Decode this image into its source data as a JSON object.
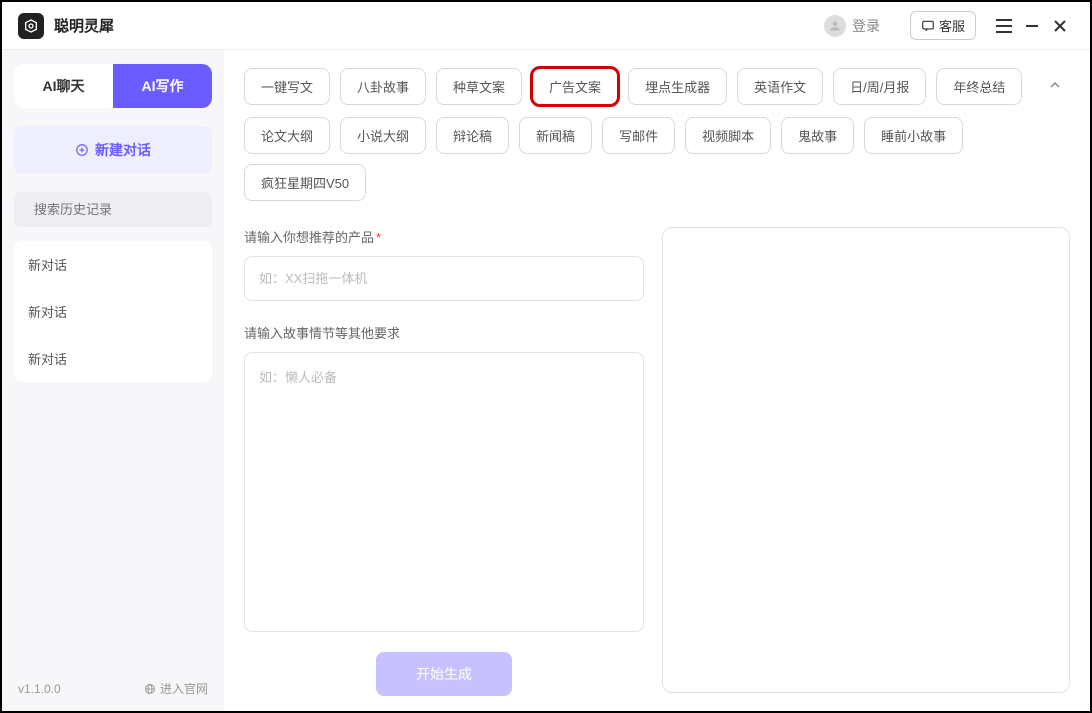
{
  "titlebar": {
    "app_name": "聪明灵犀",
    "login_label": "登录",
    "cs_label": "客服"
  },
  "sidebar": {
    "mode_chat": "AI聊天",
    "mode_write": "AI写作",
    "new_chat": "新建对话",
    "search_placeholder": "搜索历史记录",
    "items": [
      {
        "label": "新对话"
      },
      {
        "label": "新对话"
      },
      {
        "label": "新对话"
      }
    ],
    "version": "v1.1.0.0",
    "official_site": "进入官网"
  },
  "templates": {
    "row1": [
      "一键写文",
      "八卦故事",
      "种草文案",
      "广告文案",
      "埋点生成器",
      "英语作文",
      "日/周/月报",
      "年终总结"
    ],
    "row2": [
      "论文大纲",
      "小说大纲",
      "辩论稿",
      "新闻稿",
      "写邮件",
      "视频脚本",
      "鬼故事",
      "睡前小故事",
      "疯狂星期四V50"
    ],
    "highlighted_index_row1": 3
  },
  "form": {
    "product_label": "请输入你想推荐的产品",
    "product_placeholder": "如：XX扫拖一体机",
    "detail_label": "请输入故事情节等其他要求",
    "detail_placeholder": "如：懒人必备",
    "generate_label": "开始生成"
  }
}
